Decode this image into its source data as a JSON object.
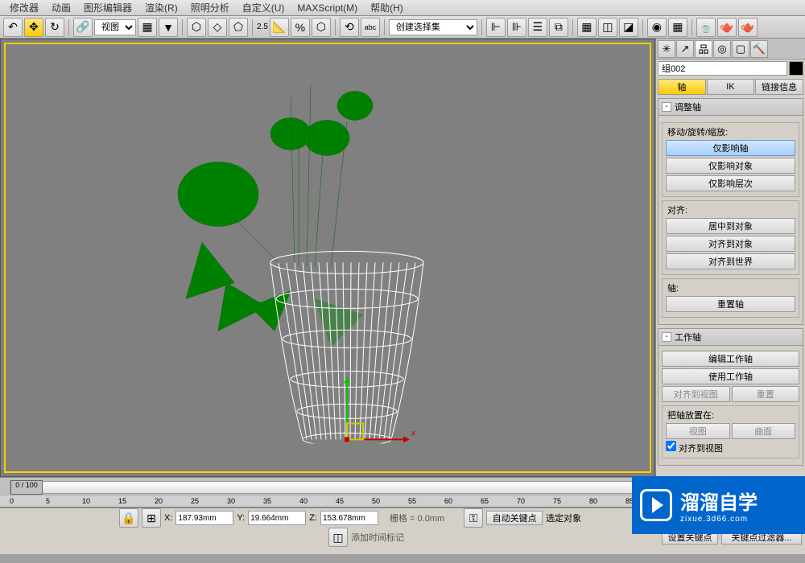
{
  "menu": {
    "items": [
      "修改器",
      "动画",
      "图形编辑器",
      "渲染(R)",
      "照明分析",
      "自定义(U)",
      "MAXScript(M)",
      "帮助(H)"
    ]
  },
  "toolbar": {
    "view_dropdown": "视图",
    "create_set": "创建选择集",
    "snap_val": "2.5"
  },
  "object": {
    "name": "组002"
  },
  "tabs": {
    "pivot": "轴",
    "ik": "IK",
    "link": "链接信息"
  },
  "rollouts": {
    "adjust_pivot": {
      "title": "调整轴",
      "move_section": "移动/旋转/缩放:",
      "affect_pivot_only": "仅影响轴",
      "affect_object_only": "仅影响对象",
      "affect_hierarchy": "仅影响层次",
      "align_section": "对齐:",
      "center_to_object": "居中到对象",
      "align_to_object": "对齐到对象",
      "align_to_world": "对齐到世界",
      "pivot_section": "轴:",
      "reset_pivot": "重置轴"
    },
    "working_pivot": {
      "title": "工作轴",
      "edit": "编辑工作轴",
      "use": "使用工作轴",
      "align_view": "对齐到视图",
      "reset": "重置",
      "place_section": "把轴放置在:",
      "view": "视图",
      "surface": "曲面",
      "align_to_view_chk": "对齐到视图"
    }
  },
  "coords": {
    "x_label": "X:",
    "x": "187.93mm",
    "y_label": "Y:",
    "y": "19.664mm",
    "z_label": "Z:",
    "z": "153.678mm",
    "grid": "栅格 = 0.0mm"
  },
  "status": {
    "add_time_tag": "添加时间标记",
    "auto_key": "自动关键点",
    "selected": "选定对象",
    "set_key": "设置关键点",
    "key_filters": "关键点过滤器..."
  },
  "ruler_ticks": [
    "0",
    "5",
    "10",
    "15",
    "20",
    "25",
    "30",
    "35",
    "40",
    "45",
    "50",
    "55",
    "60",
    "65",
    "70",
    "75",
    "80",
    "85"
  ],
  "timeline_frame": "0 / 100",
  "watermark": {
    "main": "溜溜自学",
    "sub": "zixue.3d66.com"
  }
}
